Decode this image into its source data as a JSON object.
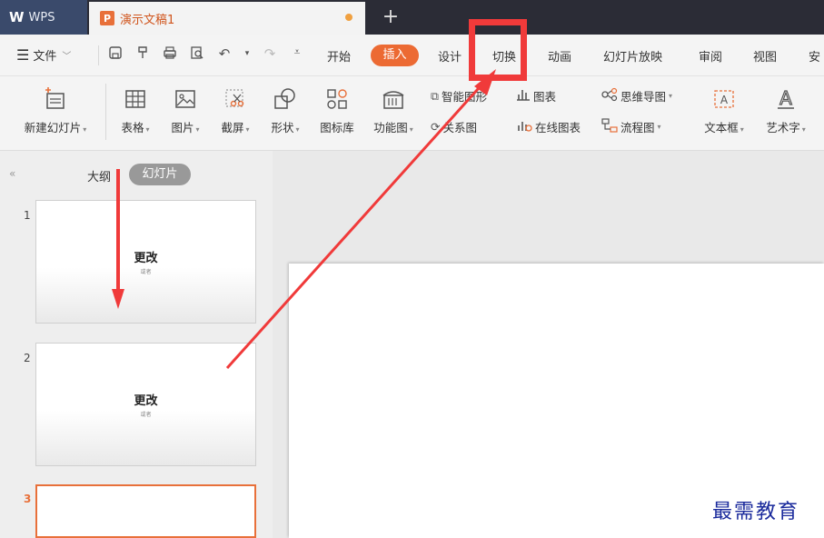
{
  "titlebar": {
    "app_logo": "W",
    "app_name": "WPS",
    "document_tab": "演示文稿1",
    "doc_icon_letter": "P",
    "new_tab": "+"
  },
  "menubar": {
    "file_label": "文件",
    "tabs": [
      "开始",
      "插入",
      "设计",
      "切换",
      "动画",
      "幻灯片放映",
      "审阅",
      "视图",
      "安"
    ],
    "active_tab": "插入",
    "highlighted_tab": "切换"
  },
  "ribbon": {
    "new_slide": "新建幻灯片",
    "table": "表格",
    "picture": "图片",
    "screenshot": "截屏",
    "shape": "形状",
    "icon_library": "图标库",
    "function_chart": "功能图",
    "smart_shape": "智能图形",
    "chart": "图表",
    "relation_chart": "关系图",
    "online_chart": "在线图表",
    "mind_map": "思维导图",
    "flow_chart": "流程图",
    "text_box": "文本框",
    "word_art": "艺术字"
  },
  "leftpanel": {
    "collapse": "«",
    "outline_tab": "大纲",
    "slides_tab": "幻灯片",
    "slides": [
      {
        "number": "1",
        "title": "更改",
        "subtitle": "或者"
      },
      {
        "number": "2",
        "title": "更改",
        "subtitle": "或者"
      },
      {
        "number": "3",
        "title": "",
        "subtitle": ""
      }
    ]
  },
  "watermark": "最需教育",
  "colors": {
    "accent": "#ec6a33",
    "annotation_red": "#f03a3a",
    "titlebar": "#2b2c36",
    "watermark": "#1a2a9c"
  }
}
